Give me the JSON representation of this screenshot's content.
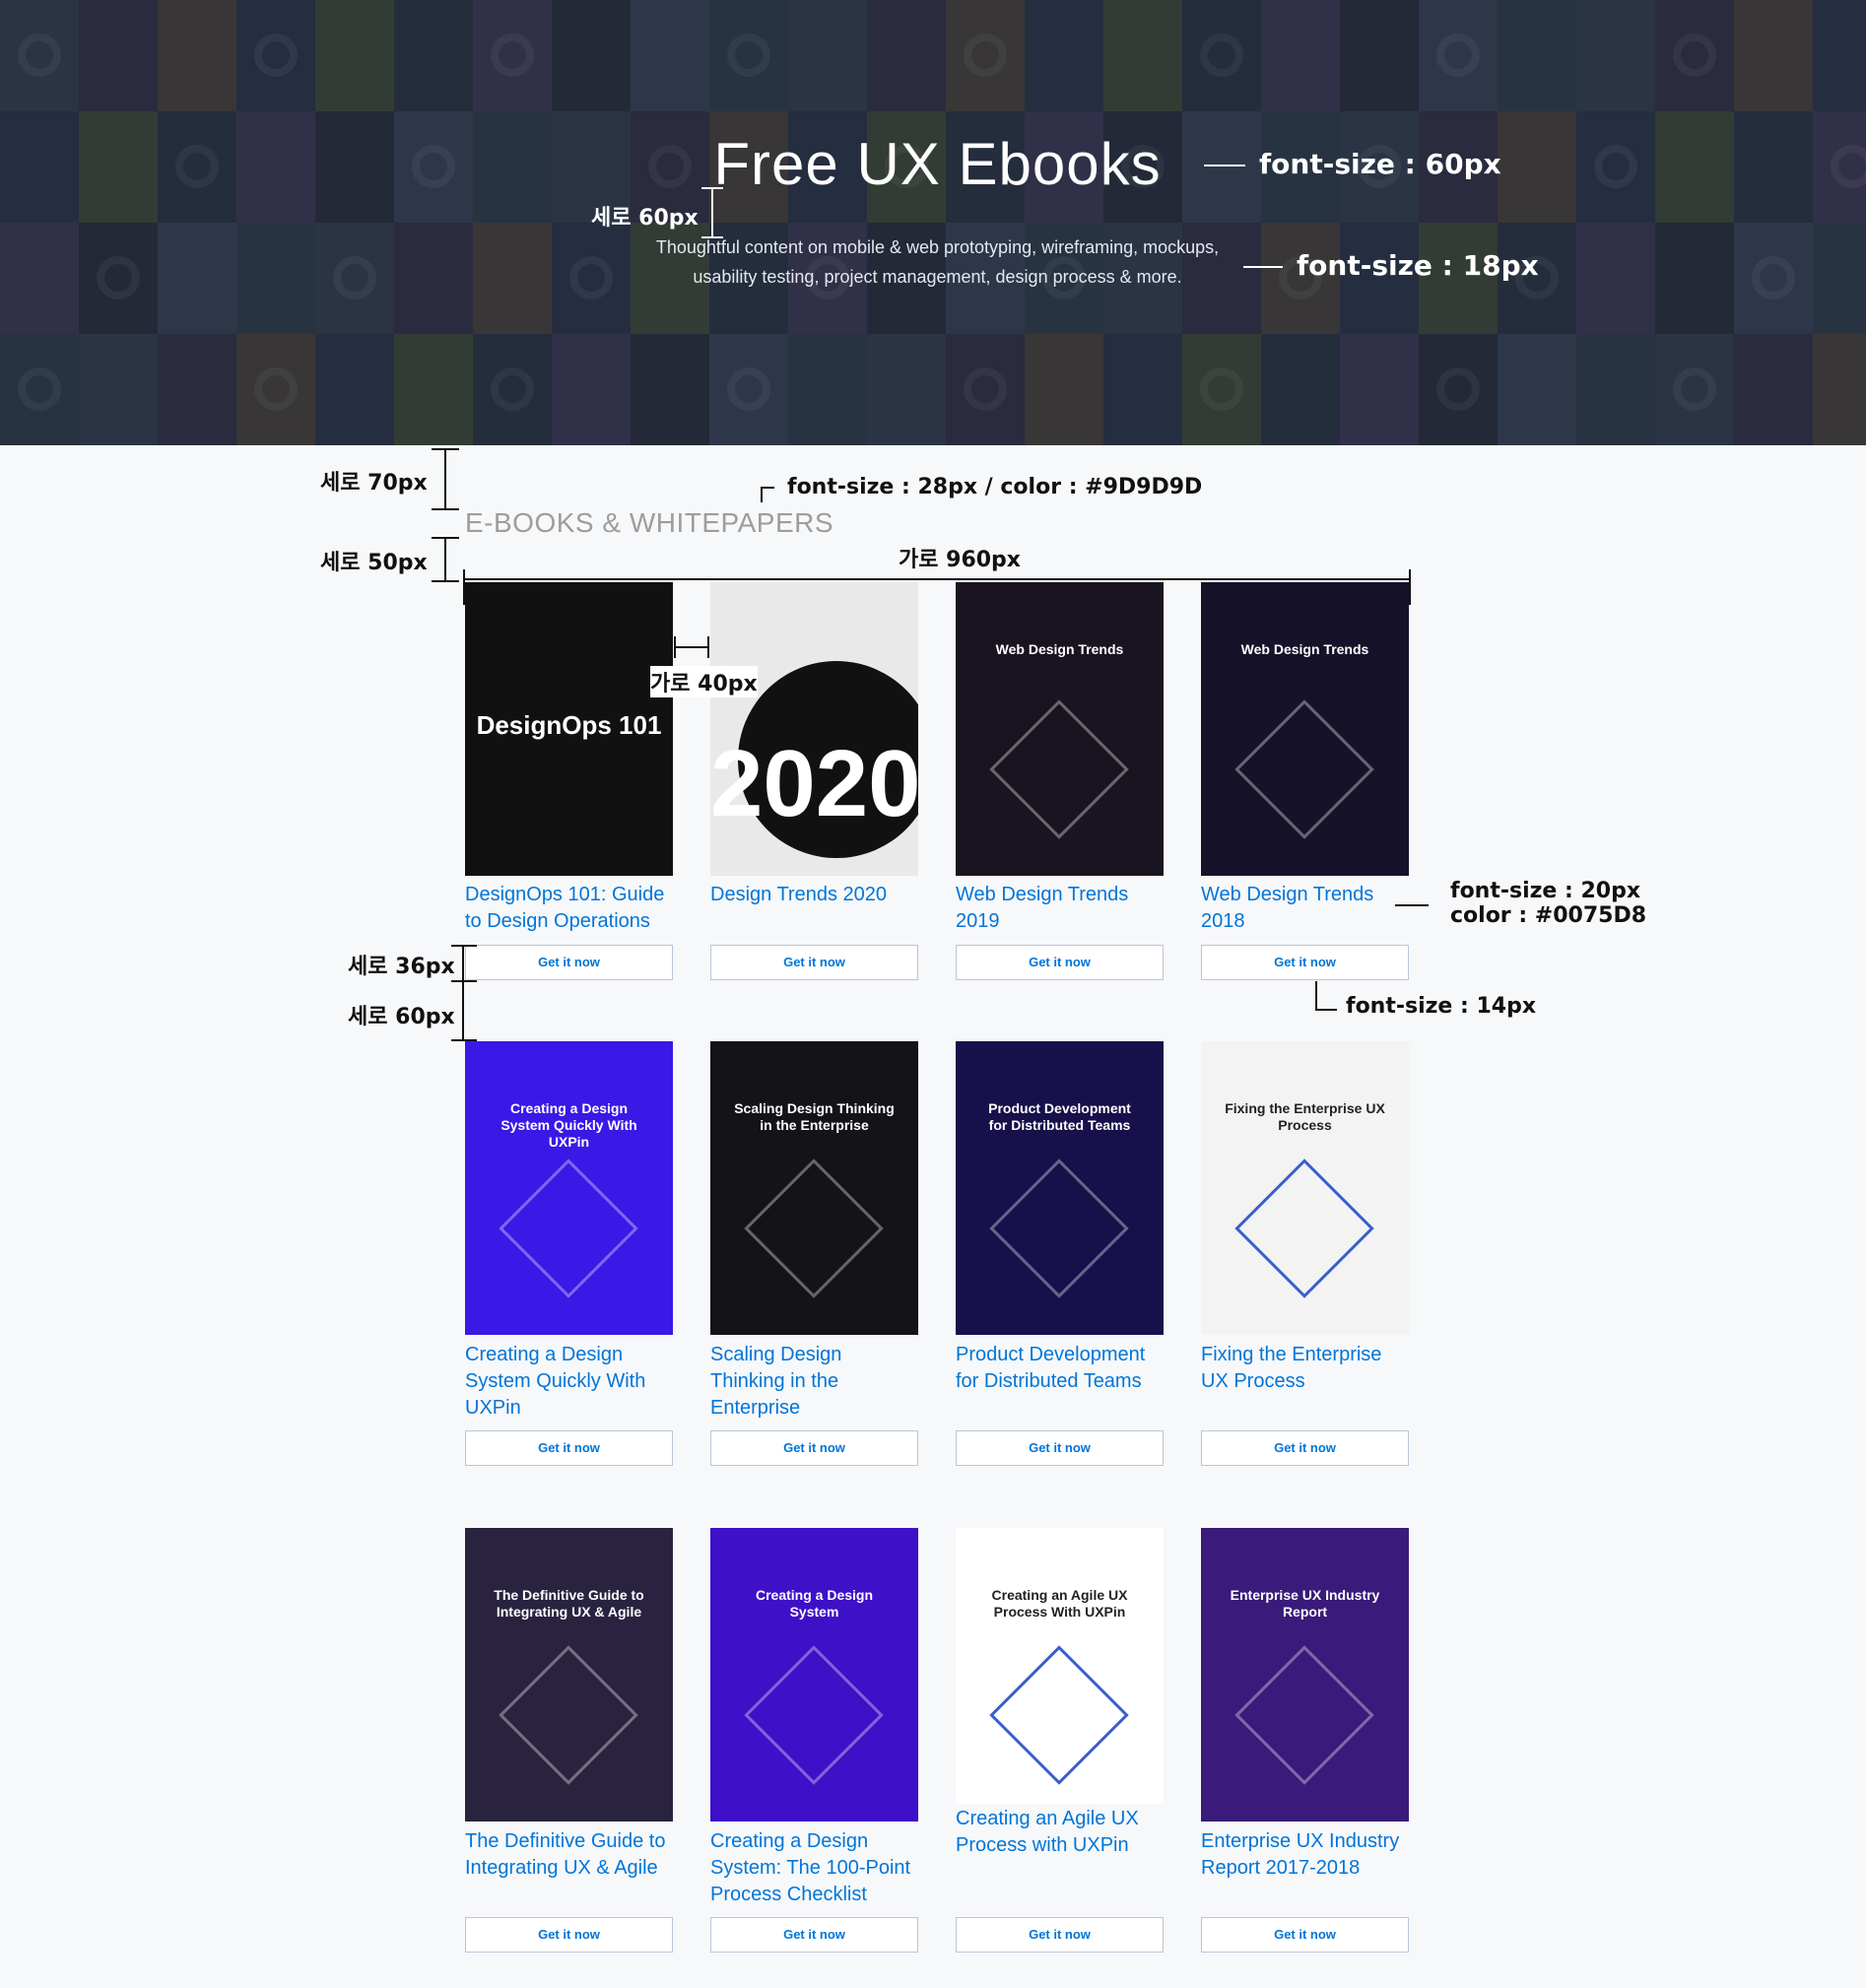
{
  "hero": {
    "title": "Free UX Ebooks",
    "subtitle_line1": "Thoughtful content on mobile & web prototyping, wireframing, mockups,",
    "subtitle_line2": "usability testing, project management, design process & more."
  },
  "section": {
    "title": "E-BOOKS & WHITEPAPERS"
  },
  "annotations": {
    "title_size": "font-size : 60px",
    "sub_size": "font-size : 18px",
    "gap_60_top": "세로 60px",
    "gap_70": "세로 70px",
    "section_style": "font-size : 28px / color : #9D9D9D",
    "gap_50": "세로 50px",
    "width_960": "가로 960px",
    "width_40": "가로 40px",
    "title_size_20": "font-size : 20px",
    "title_color": "color : #0075D8",
    "gap_36": "세로 36px",
    "gap_60_row": "세로 60px",
    "btn_size": "font-size : 14px"
  },
  "button_label": "Get it now",
  "books": [
    {
      "title": "DesignOps 101: Guide to Design Operations",
      "cover_text": "DesignOps 101",
      "cover_color": "#111111"
    },
    {
      "title": "Design Trends 2020",
      "cover_text": "2020",
      "cover_color": "#e9e9e9"
    },
    {
      "title": "Web Design Trends 2019",
      "cover_text": "Web Design Trends",
      "cover_color": "#1a1420"
    },
    {
      "title": "Web Design Trends 2018",
      "cover_text": "Web Design Trends",
      "cover_color": "#16122a"
    },
    {
      "title": "Creating a Design System Quickly With UXPin",
      "cover_text": "Creating a Design System Quickly With UXPin",
      "cover_color": "#3a18e6"
    },
    {
      "title": "Scaling Design Thinking in the Enterprise",
      "cover_text": "Scaling Design Thinking in the Enterprise",
      "cover_color": "#141418"
    },
    {
      "title": "Product Development for Distributed Teams",
      "cover_text": "Product Development for Distributed Teams",
      "cover_color": "#17104a"
    },
    {
      "title": "Fixing the Enterprise UX Process",
      "cover_text": "Fixing the Enterprise UX Process",
      "cover_color": "#f3f3f3"
    },
    {
      "title": "The Definitive Guide to Integrating UX & Agile",
      "cover_text": "The Definitive Guide to Integrating UX & Agile",
      "cover_color": "#2a2340"
    },
    {
      "title": "Creating a Design System: The 100-Point Process Checklist",
      "cover_text": "Creating a Design System",
      "cover_color": "#3e10c8"
    },
    {
      "title": "Creating an Agile UX Process with UXPin",
      "cover_text": "Creating an Agile UX Process With UXPin",
      "cover_color": "#ffffff"
    },
    {
      "title": "Enterprise UX Industry Report 2017-2018",
      "cover_text": "Enterprise UX Industry Report",
      "cover_color": "#3a1a7a"
    }
  ]
}
